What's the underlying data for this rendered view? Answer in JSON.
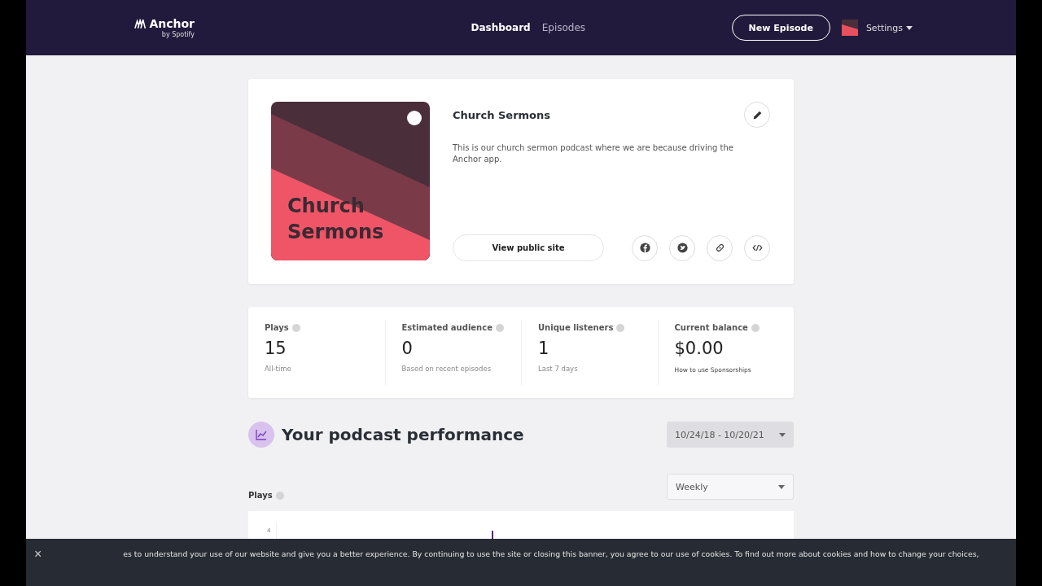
{
  "nav": {
    "logo": "Anchor",
    "logo_sub": "by Spotify",
    "links": [
      {
        "label": "Dashboard",
        "selected": true
      },
      {
        "label": "Episodes",
        "selected": false
      }
    ],
    "new_button": "New Episode",
    "settings": "Settings"
  },
  "podcast": {
    "cover_title": "Church Sermons",
    "title": "Church Sermons",
    "description": "This is our church sermon podcast where we are because driving the Anchor app.",
    "view_button": "View public site",
    "share": [
      {
        "kind": "facebook"
      },
      {
        "kind": "twitter"
      },
      {
        "kind": "link"
      },
      {
        "kind": "embed"
      }
    ]
  },
  "stats": [
    {
      "label": "Plays",
      "value": "15",
      "note": "All-time",
      "kind": "plain"
    },
    {
      "label": "Estimated audience",
      "value": "0",
      "note": "Based on recent episodes",
      "kind": "plain"
    },
    {
      "label": "Unique listeners",
      "value": "1",
      "note": "Last 7 days",
      "kind": "plain"
    },
    {
      "label": "Current balance",
      "value": "$0.00",
      "note": "How to use Sponsorships",
      "kind": "link"
    }
  ],
  "performance": {
    "title": "Your podcast performance",
    "date_range": "10/24/18 - 10/20/21",
    "interval": "Weekly",
    "chart_label": "Plays",
    "y_tick": "4"
  },
  "cookie_banner": {
    "text": "es to understand your use of our website and give you a better experience. By continuing to use the site or closing this banner, you agree to our use of cookies. To find out more about cookies and how to change your choices,",
    "close": "×"
  }
}
